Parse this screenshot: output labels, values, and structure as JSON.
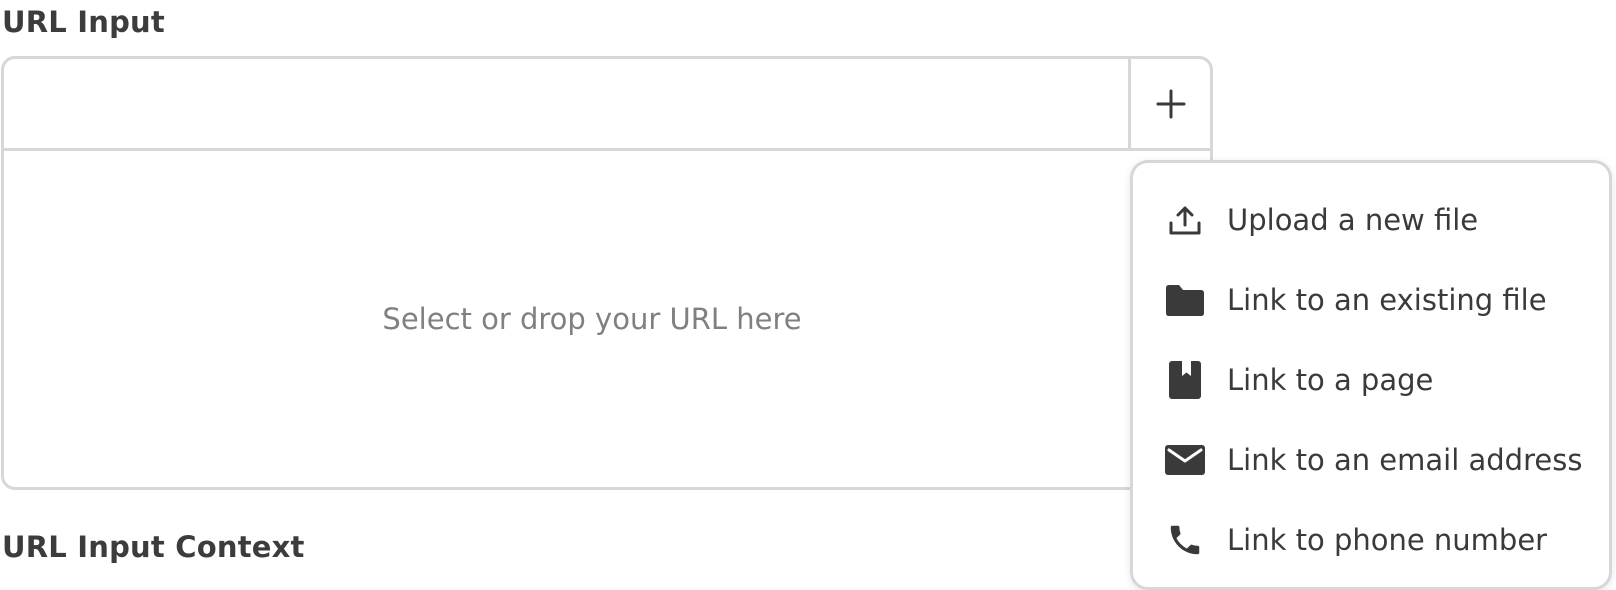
{
  "fields": {
    "url_input": {
      "label": "URL Input",
      "value": "",
      "placeholder": "",
      "dropzone_text": "Select or drop your URL here",
      "add_button_icon": "plus-icon"
    },
    "url_input_context": {
      "label": "URL Input Context"
    }
  },
  "menu": {
    "items": [
      {
        "label": "Upload a new file",
        "icon": "upload-icon"
      },
      {
        "label": "Link to an existing file",
        "icon": "folder-icon"
      },
      {
        "label": "Link to a page",
        "icon": "page-bookmark-icon"
      },
      {
        "label": "Link to an email address",
        "icon": "envelope-icon"
      },
      {
        "label": "Link to phone number",
        "icon": "phone-icon"
      }
    ]
  },
  "colors": {
    "icon": "#3a3a3a",
    "border": "#d7d7d7",
    "muted_text": "#808080"
  }
}
